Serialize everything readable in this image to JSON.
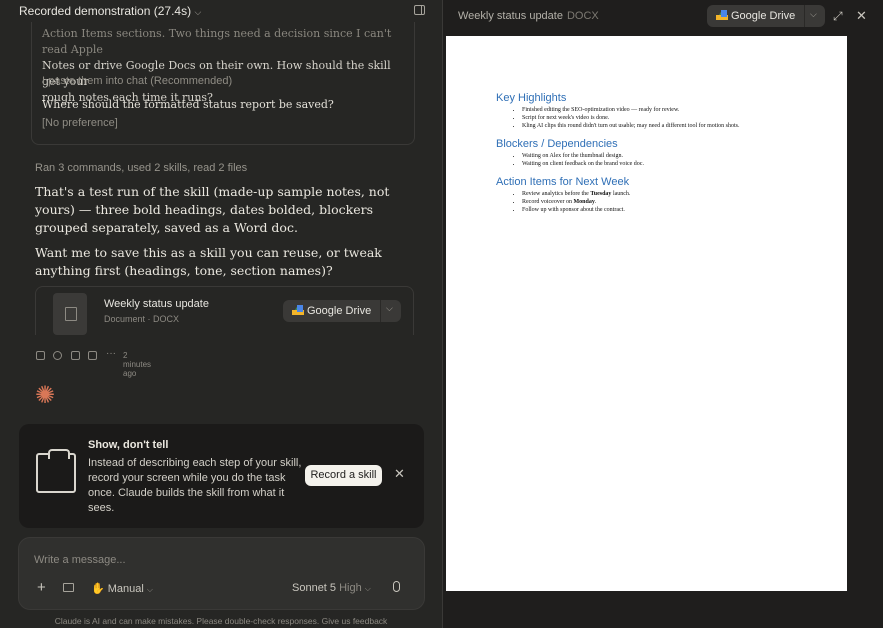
{
  "header": {
    "title": "Recorded demonstration (27.4s)"
  },
  "chat": {
    "question1_line1": "Action Items sections. Two things need a decision since I can't read Apple",
    "question1_line2": "Notes or drive Google Docs on their own. How should the skill get your",
    "question1_line3": "rough notes each time it runs?",
    "answer1": "I paste them into chat (Recommended)",
    "question2": "Where should the formatted status report be saved?",
    "answer2": "[No preference]",
    "ran_label": "Ran 3 commands, used 2 skills, read 2 files",
    "para1": "That's a test run of the skill (made-up sample notes, not yours) — three bold headings, dates bolded, blockers grouped separately, saved as a Word doc.",
    "para2": "Want me to save this as a skill you can reuse, or tweak anything first (headings, tone, section names)?",
    "file_title": "Weekly status update",
    "file_sub": "Document · DOCX",
    "gdrive_label": "Google Drive",
    "timestamp": "2 minutes ago"
  },
  "promo": {
    "title": "Show, don't tell",
    "body": "Instead of describing each step of your skill, record your screen while you do the task once. Claude builds the skill from what it sees.",
    "button": "Record a skill"
  },
  "composer": {
    "placeholder": "Write a message...",
    "mode": "Manual",
    "model": "Sonnet 5",
    "effort": "High"
  },
  "footer": "Claude is AI and can make mistakes. Please double-check responses. Give us feedback",
  "preview": {
    "title": "Weekly status update",
    "type": "DOCX",
    "gdrive_label": "Google Drive",
    "doc": {
      "h1": "Key Highlights",
      "h1_items": [
        "Finished editing the SEO-optimization video — ready for review.",
        "Script for next week's video is done.",
        "Kling AI clips this round didn't turn out usable; may need a different tool for motion shots."
      ],
      "h2": "Blockers / Dependencies",
      "h2_items": [
        "Waiting on Alex for the thumbnail design.",
        "Waiting on client feedback on the brand voice doc."
      ],
      "h3": "Action Items for Next Week",
      "h3_item1_pre": "Review analytics before the ",
      "h3_item1_bold": "Tuesday",
      "h3_item1_post": " launch.",
      "h3_item2_pre": "Record voiceover on ",
      "h3_item2_bold": "Monday",
      "h3_item2_post": ".",
      "h3_item3": "Follow up with sponsor about the contract."
    }
  },
  "colors": {
    "accent": "#d97757",
    "heading_blue": "#2f6fb6"
  }
}
